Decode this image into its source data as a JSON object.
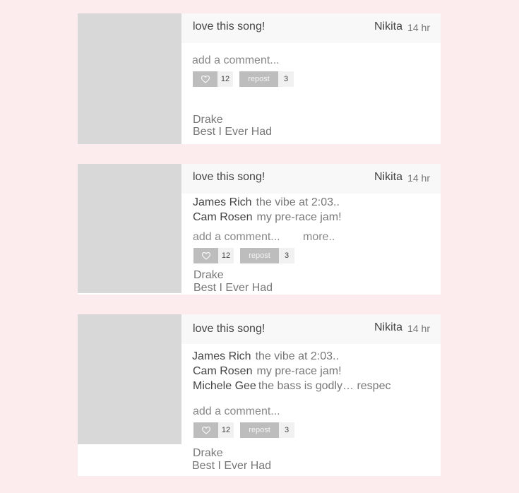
{
  "posts": [
    {
      "caption": "love this song!",
      "user": "Nikita",
      "time": "14 hr",
      "comments": [],
      "add_comment_placeholder": "add a comment...",
      "more_label": "",
      "likes": "12",
      "repost_label": "repost",
      "reposts": "3",
      "artist": "Drake",
      "track": "Best I Ever Had"
    },
    {
      "caption": "love this song!",
      "user": "Nikita",
      "time": "14 hr",
      "comments": [
        {
          "name": "James Rich",
          "text": "the vibe at 2:03.."
        },
        {
          "name": "Cam Rosen",
          "text": "my pre-race jam!"
        }
      ],
      "add_comment_placeholder": "add a comment...",
      "more_label": "more..",
      "likes": "12",
      "repost_label": "repost",
      "reposts": "3",
      "artist": "Drake",
      "track": "Best I Ever Had"
    },
    {
      "caption": "love this song!",
      "user": "Nikita",
      "time": "14 hr",
      "comments": [
        {
          "name": "James Rich",
          "text": "the vibe at 2:03.."
        },
        {
          "name": "Cam Rosen",
          "text": "my pre-race jam!"
        },
        {
          "name": "Michele Gee",
          "text": "the bass is godly… respec"
        }
      ],
      "add_comment_placeholder": "add a comment...",
      "more_label": "",
      "likes": "12",
      "repost_label": "repost",
      "reposts": "3",
      "artist": "Drake",
      "track": "Best I Ever Had"
    }
  ],
  "icons": {
    "like": "heart-outline-icon"
  }
}
